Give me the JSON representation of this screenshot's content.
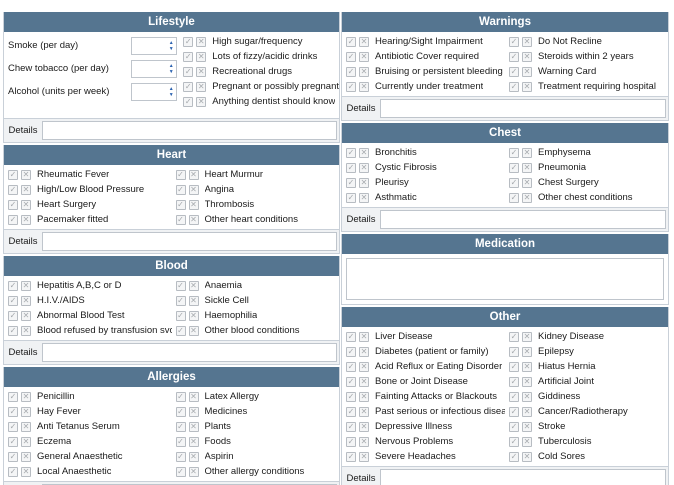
{
  "check_glyph": "✓",
  "cross_glyph": "✕",
  "details_label": "Details",
  "lifestyle": {
    "title": "Lifestyle",
    "fields": [
      {
        "label": "Smoke (per day)",
        "value": ""
      },
      {
        "label": "Chew tobacco (per day)",
        "value": ""
      },
      {
        "label": "Alcohol (units per week)",
        "value": ""
      }
    ],
    "items": [
      "High sugar/frequency",
      "Lots of fizzy/acidic drinks",
      "Recreational drugs",
      "Pregnant or possibly pregnant",
      "Anything dentist should know"
    ]
  },
  "heart": {
    "title": "Heart",
    "rows": [
      [
        "Rheumatic Fever",
        "Heart Murmur"
      ],
      [
        "High/Low Blood Pressure",
        "Angina"
      ],
      [
        "Heart Surgery",
        "Thrombosis"
      ],
      [
        "Pacemaker fitted",
        "Other heart conditions"
      ]
    ]
  },
  "blood": {
    "title": "Blood",
    "rows": [
      [
        "Hepatitis A,B,C or D",
        "Anaemia"
      ],
      [
        "H.I.V./AIDS",
        "Sickle Cell"
      ],
      [
        "Abnormal Blood Test",
        "Haemophilia"
      ],
      [
        "Blood refused by transfusion svce.",
        "Other blood conditions"
      ]
    ]
  },
  "allergies": {
    "title": "Allergies",
    "rows": [
      [
        "Penicillin",
        "Latex Allergy"
      ],
      [
        "Hay Fever",
        "Medicines"
      ],
      [
        "Anti Tetanus Serum",
        "Plants"
      ],
      [
        "Eczema",
        "Foods"
      ],
      [
        "General Anaesthetic",
        "Aspirin"
      ],
      [
        "Local Anaesthetic",
        "Other allergy conditions"
      ]
    ]
  },
  "warnings": {
    "title": "Warnings",
    "rows": [
      [
        "Hearing/Sight Impairment",
        "Do Not Recline"
      ],
      [
        "Antibiotic Cover required",
        "Steroids within 2 years"
      ],
      [
        "Bruising or persistent bleeding",
        "Warning Card"
      ],
      [
        "Currently under treatment",
        "Treatment requiring hospital"
      ]
    ]
  },
  "chest": {
    "title": "Chest",
    "rows": [
      [
        "Bronchitis",
        "Emphysema"
      ],
      [
        "Cystic Fibrosis",
        "Pneumonia"
      ],
      [
        "Pleurisy",
        "Chest Surgery"
      ],
      [
        "Asthmatic",
        "Other chest conditions"
      ]
    ]
  },
  "medication": {
    "title": "Medication",
    "value": ""
  },
  "other": {
    "title": "Other",
    "rows": [
      [
        "Liver Disease",
        "Kidney Disease"
      ],
      [
        "Diabetes (patient or family)",
        "Epilepsy"
      ],
      [
        "Acid Reflux or Eating Disorder",
        "Hiatus Hernia"
      ],
      [
        "Bone or Joint Disease",
        "Artificial Joint"
      ],
      [
        "Fainting Attacks or Blackouts",
        "Giddiness"
      ],
      [
        "Past serious or infectious disease",
        "Cancer/Radiotherapy"
      ],
      [
        "Depressive Illness",
        "Stroke"
      ],
      [
        "Nervous Problems",
        "Tuberculosis"
      ],
      [
        "Severe Headaches",
        "Cold Sores"
      ]
    ]
  }
}
